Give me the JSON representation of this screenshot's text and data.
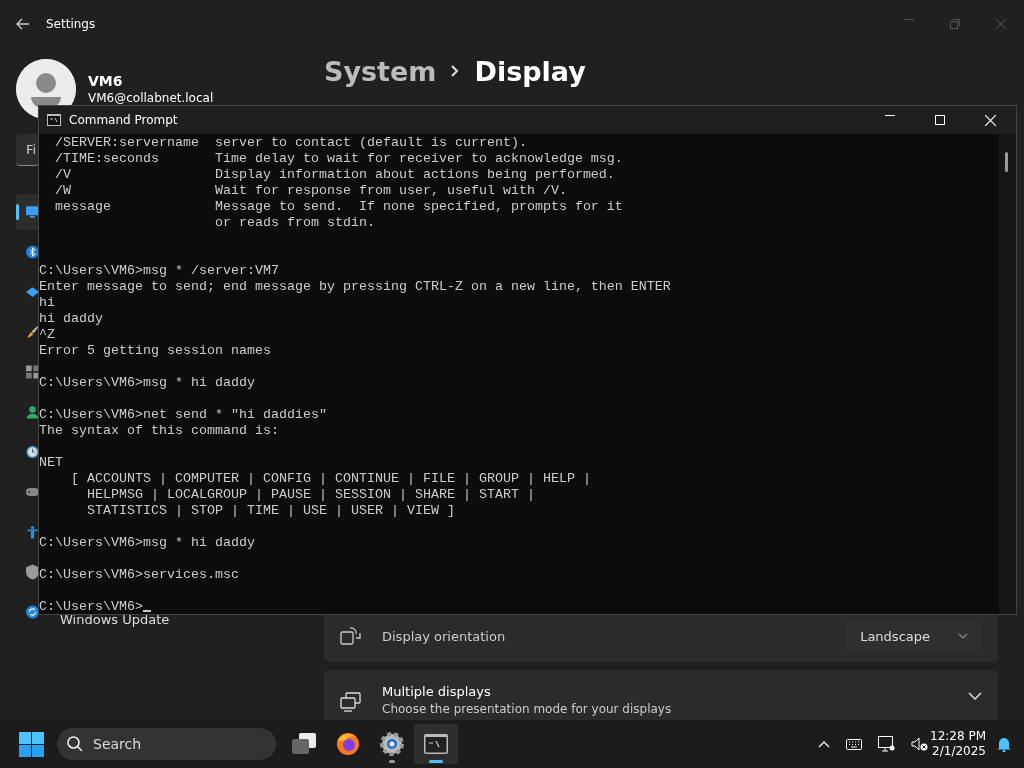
{
  "settings": {
    "title": "Settings",
    "profile": {
      "name": "VM6",
      "email": "VM6@collabnet.local"
    },
    "search": {
      "placeholder": "Fi"
    },
    "sidebar": {
      "items": [
        {
          "selected": true
        },
        {
          "selected": false
        },
        {
          "selected": false
        },
        {
          "selected": false
        },
        {
          "selected": false
        },
        {
          "selected": false
        },
        {
          "selected": false
        },
        {
          "selected": false
        },
        {
          "selected": false
        },
        {
          "selected": false
        },
        {
          "selected": false,
          "label": "Windows Update"
        }
      ]
    },
    "breadcrumb": [
      {
        "label": "System",
        "selected": false
      },
      {
        "label": "Display",
        "selected": true
      }
    ],
    "cards": [
      {
        "kind": "dropdown",
        "title": "Display orientation",
        "value": "Landscape"
      },
      {
        "kind": "expander",
        "title": "Multiple displays",
        "subtitle": "Choose the presentation mode for your displays",
        "expanded": false
      }
    ]
  },
  "command_prompt": {
    "title": "Command Prompt",
    "cursor_visible": true,
    "blocks": [
      {
        "trailing_blank": true,
        "lines": [
          "  /SERVER:servername  server to contact (default is current).",
          "  /TIME:seconds       Time delay to wait for receiver to acknowledge msg.",
          "  /V                  Display information about actions being performed.",
          "  /W                  Wait for response from user, useful with /V.",
          "  message             Message to send.  If none specified, prompts for it",
          "                      or reads from stdin."
        ]
      },
      {
        "lines": [
          "C:\\Users\\VM6>msg * /server:VM7",
          "Enter message to send; end message by pressing CTRL-Z on a new line, then ENTER",
          "hi",
          "hi daddy",
          "^Z",
          "Error 5 getting session names"
        ]
      },
      {
        "lines": [
          "C:\\Users\\VM6>msg * hi daddy"
        ]
      },
      {
        "lines": [
          "C:\\Users\\VM6>net send * \"hi daddies\"",
          "The syntax of this command is:"
        ]
      },
      {
        "lines": [
          "NET",
          "    [ ACCOUNTS | COMPUTER | CONFIG | CONTINUE | FILE | GROUP | HELP |",
          "      HELPMSG | LOCALGROUP | PAUSE | SESSION | SHARE | START |",
          "      STATISTICS | STOP | TIME | USE | USER | VIEW ]"
        ]
      },
      {
        "lines": [
          "C:\\Users\\VM6>msg * hi daddy"
        ]
      },
      {
        "lines": [
          "C:\\Users\\VM6>services.msc"
        ]
      },
      {
        "lines": [
          "C:\\Users\\VM6>"
        ]
      }
    ]
  },
  "taskbar": {
    "search": {
      "placeholder": "Search"
    },
    "apps": [
      {
        "kind": "taskview",
        "running": false,
        "selected": false
      },
      {
        "kind": "browser",
        "running": false,
        "selected": false
      },
      {
        "kind": "settings",
        "running": true,
        "selected": false
      },
      {
        "kind": "terminal",
        "running": true,
        "selected": true
      }
    ],
    "time": "12:28 PM",
    "date": "2/1/2025"
  }
}
